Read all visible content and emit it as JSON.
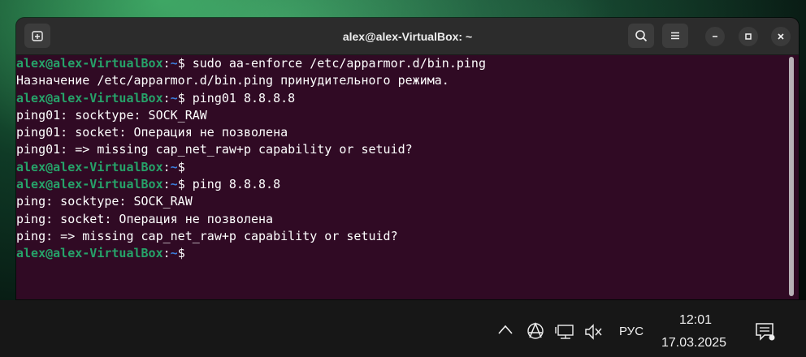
{
  "window": {
    "title": "alex@alex-VirtualBox: ~"
  },
  "icons": {
    "new_tab": "new-tab-icon",
    "search": "search-icon",
    "menu": "hamburger-menu-icon",
    "minimize": "minimize-icon",
    "maximize": "maximize-icon",
    "close": "close-icon"
  },
  "terminal": {
    "prompt": {
      "user": "alex@alex-VirtualBox",
      "colon": ":",
      "path": "~",
      "symbol": "$"
    },
    "lines": [
      {
        "type": "prompt",
        "command": " sudo aa-enforce /etc/apparmor.d/bin.ping"
      },
      {
        "type": "output",
        "text": "Назначение /etc/apparmor.d/bin.ping принудительного режима."
      },
      {
        "type": "prompt",
        "command": " ping01 8.8.8.8"
      },
      {
        "type": "output",
        "text": "ping01: socktype: SOCK_RAW"
      },
      {
        "type": "output",
        "text": "ping01: socket: Операция не позволена"
      },
      {
        "type": "output",
        "text": "ping01: => missing cap_net_raw+p capability or setuid?"
      },
      {
        "type": "prompt",
        "command": ""
      },
      {
        "type": "prompt",
        "command": " ping 8.8.8.8"
      },
      {
        "type": "output",
        "text": "ping: socktype: SOCK_RAW"
      },
      {
        "type": "output",
        "text": "ping: socket: Операция не позволена"
      },
      {
        "type": "output",
        "text": "ping: => missing cap_net_raw+p capability or setuid?"
      },
      {
        "type": "prompt",
        "command": ""
      }
    ]
  },
  "taskbar": {
    "tray_icons": [
      "chevron-up-icon",
      "anarchy-icon",
      "network-icon",
      "speaker-muted-icon"
    ],
    "language": "РУС",
    "time": "12:01",
    "date": "17.03.2025",
    "notification_icon": "notification-icon"
  },
  "colors": {
    "terminal_bg": "#300a24",
    "prompt_user": "#26a269",
    "prompt_path": "#3c7dd9",
    "titlebar_bg": "#2c2c2c",
    "taskbar_bg": "#171717"
  }
}
